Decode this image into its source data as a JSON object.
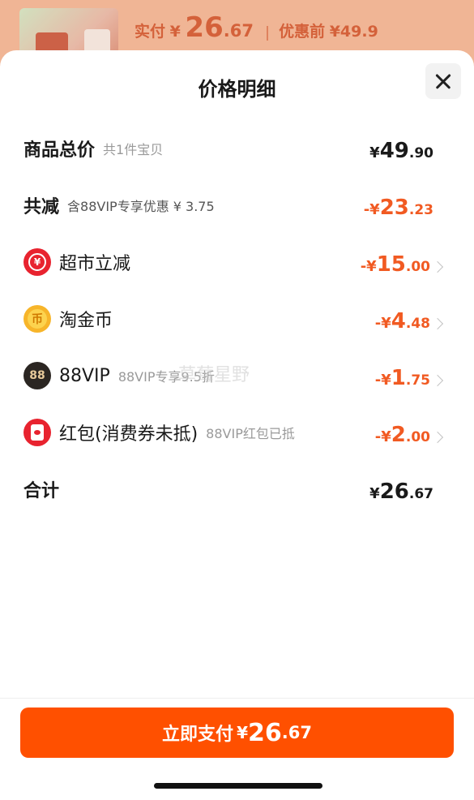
{
  "background": {
    "price_label": "实付",
    "price_currency": "¥",
    "price_int": "26",
    "price_dec": ".67",
    "original_label": "优惠前",
    "original_price": "¥49.9"
  },
  "sheet": {
    "title": "价格明细"
  },
  "rows": [
    {
      "name": "商品总价",
      "sub": "共1件宝贝",
      "currency": "¥",
      "int": "49",
      "dec": ".90"
    },
    {
      "name": "共减",
      "sub": "含88VIP专享优惠 ¥ 3.75",
      "currency": "-¥",
      "int": "23",
      "dec": ".23"
    },
    {
      "name": "超市立减",
      "sub": "",
      "currency": "-¥",
      "int": "15",
      "dec": ".00",
      "icon_name": "supermarket-discount-icon"
    },
    {
      "name": "淘金币",
      "sub": "",
      "currency": "-¥",
      "int": "4",
      "dec": ".48",
      "icon_name": "taojinbi-coin-icon"
    },
    {
      "name": "88VIP",
      "sub": "88VIP专享9.5折",
      "currency": "-¥",
      "int": "1",
      "dec": ".75",
      "icon_name": "vip-88-icon",
      "icon_text": "88"
    },
    {
      "name": "红包(消费券未抵)",
      "sub": "88VIP红包已抵",
      "currency": "-¥",
      "int": "2",
      "dec": ".00",
      "icon_name": "red-envelope-icon"
    },
    {
      "name": "合计",
      "sub": "",
      "currency": "¥",
      "int": "26",
      "dec": ".67"
    }
  ],
  "icons": {
    "chaoshi_glyph": "¥",
    "coin_glyph": "币"
  },
  "watermark": "草莓星野",
  "pay_button": {
    "label": "立即支付",
    "currency": "¥",
    "int": "26",
    "dec": ".67"
  },
  "colors": {
    "accent": "#ff5000",
    "discount": "#f15a22"
  }
}
